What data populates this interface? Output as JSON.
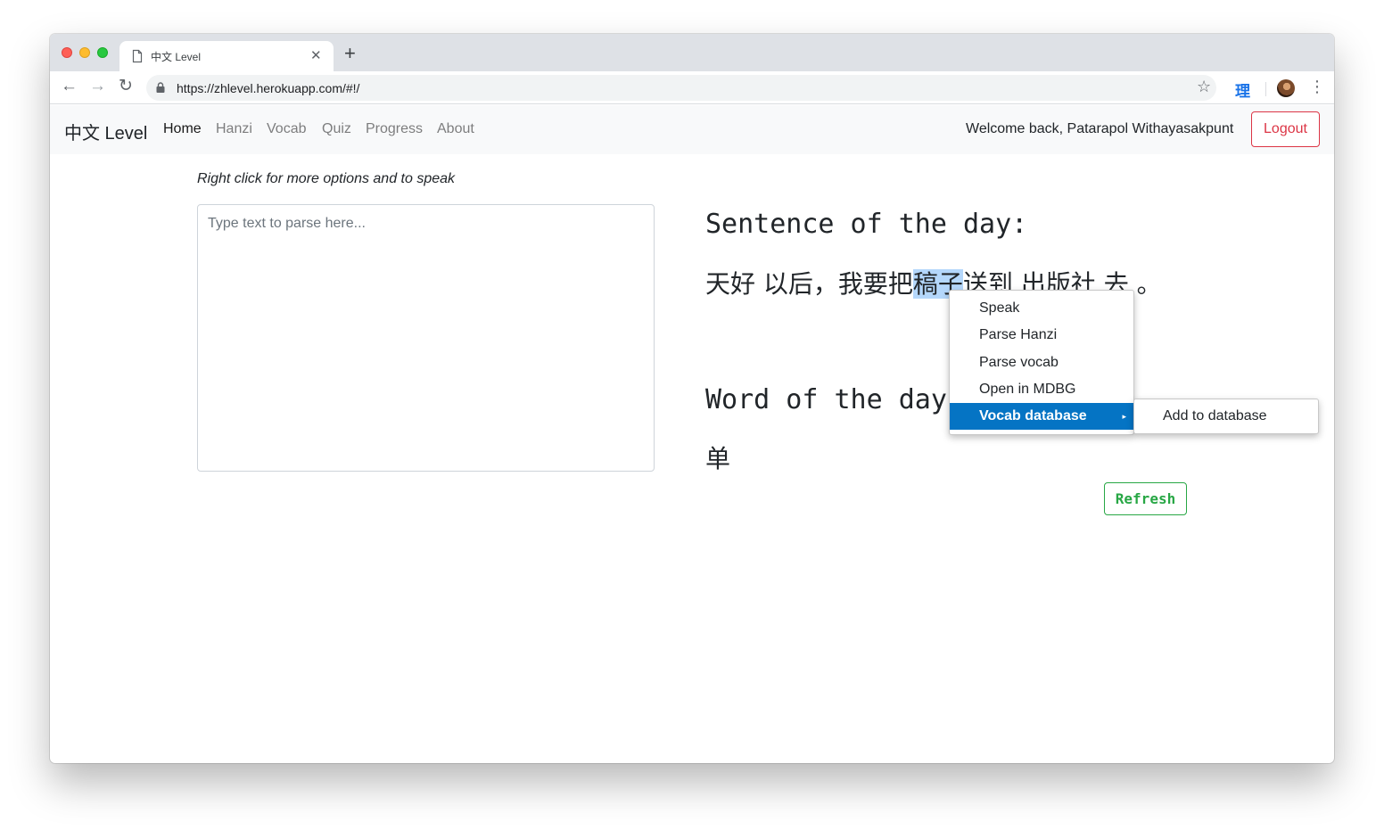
{
  "browser": {
    "tab_title": "中文 Level",
    "tab_close": "✕",
    "new_tab": "+",
    "url": "https://zhlevel.herokuapp.com/#!/",
    "back": "←",
    "forward": "→",
    "reload": "↻",
    "star": "☆",
    "extension_label": "理",
    "menu": "⋮",
    "icons": [
      "page-icon",
      "lock-icon",
      "star-icon",
      "profile-avatar",
      "menu-icon"
    ]
  },
  "navbar": {
    "brand": "中文 Level",
    "links": [
      "Home",
      "Hanzi",
      "Vocab",
      "Quiz",
      "Progress",
      "About"
    ],
    "active_link": "Home",
    "welcome": "Welcome back, Patarapol Withayasakpunt",
    "logout": "Logout"
  },
  "main": {
    "hint": "Right click for more options and to speak",
    "input_placeholder": "Type text to parse here...",
    "sentence_heading": "Sentence of the day:",
    "sentence_before": "天好 以后，我要把",
    "sentence_selected": "稿子",
    "sentence_after": "送到 出版社 去 。",
    "word_heading": "Word of the day:",
    "word": "单",
    "refresh": "Refresh"
  },
  "context_menu": {
    "items": [
      "Speak",
      "Parse Hanzi",
      "Parse vocab",
      "Open in MDBG",
      "Vocab database"
    ],
    "selected": "Vocab database",
    "arrow": "▸",
    "submenu": [
      "Add to database"
    ]
  },
  "colors": {
    "logout": "#dc3545",
    "refresh": "#28a745",
    "menu_highlight": "#0574c4",
    "selection": "#b4d7fb"
  }
}
